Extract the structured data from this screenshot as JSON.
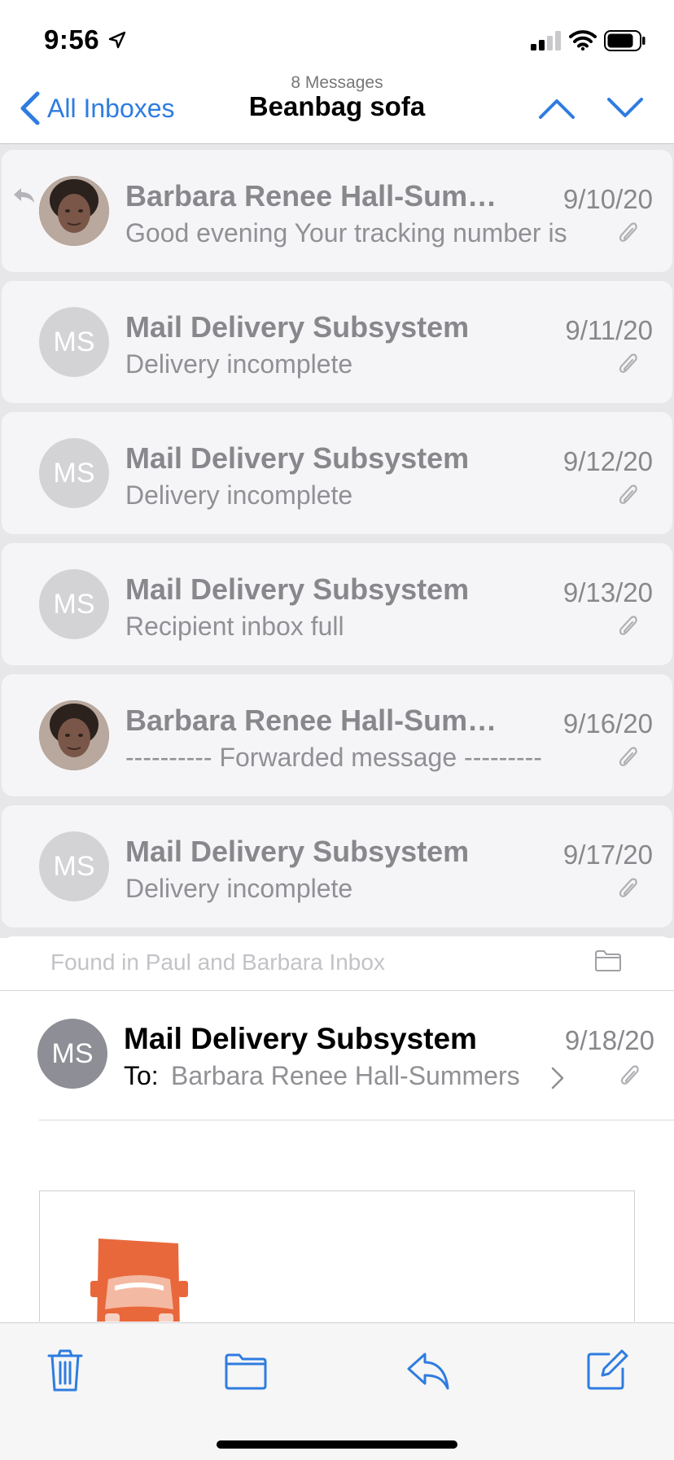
{
  "status_bar": {
    "time": "9:56",
    "icons": [
      "location-arrow-icon",
      "cellular-signal-icon",
      "wifi-icon",
      "battery-icon"
    ]
  },
  "nav": {
    "back_label": "All Inboxes",
    "subtitle": "8 Messages",
    "title": "Beanbag sofa",
    "accent_color": "#2f7ce0"
  },
  "thread": {
    "messages": [
      {
        "sender": "Barbara Renee Hall-Summers",
        "date": "9/10/20",
        "preview": "Good evening Your tracking number is",
        "avatar": "photo",
        "replied": true,
        "has_attachment": true
      },
      {
        "sender": "Mail Delivery Subsystem",
        "date": "9/11/20",
        "preview": "Delivery incomplete",
        "avatar": "MS",
        "has_attachment": true
      },
      {
        "sender": "Mail Delivery Subsystem",
        "date": "9/12/20",
        "preview": "Delivery incomplete",
        "avatar": "MS",
        "has_attachment": true
      },
      {
        "sender": "Mail Delivery Subsystem",
        "date": "9/13/20",
        "preview": "Recipient inbox full",
        "avatar": "MS",
        "has_attachment": true
      },
      {
        "sender": "Barbara Renee Hall-Summers",
        "date": "9/16/20",
        "preview": "---------- Forwarded message ---------",
        "avatar": "photo",
        "has_attachment": true
      },
      {
        "sender": "Mail Delivery Subsystem",
        "date": "9/17/20",
        "preview": "Delivery incomplete",
        "avatar": "MS",
        "has_attachment": true
      }
    ]
  },
  "found_in": {
    "label": "Found in Paul and Barbara Inbox"
  },
  "open_message": {
    "avatar": "MS",
    "sender": "Mail Delivery Subsystem",
    "date": "9/18/20",
    "to_label": "To:",
    "recipient": "Barbara Renee Hall-Summers"
  },
  "toolbar": {
    "buttons": [
      "trash-icon",
      "folder-icon",
      "reply-icon",
      "compose-icon"
    ]
  }
}
